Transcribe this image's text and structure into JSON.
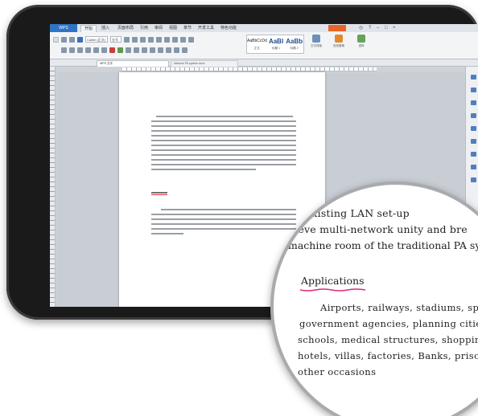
{
  "app": {
    "menu_tabs": [
      "开始",
      "插入",
      "页面布局",
      "引用",
      "审阅",
      "视图",
      "章节",
      "开发工具",
      "特色功能"
    ],
    "active_tab": "开始"
  },
  "ribbon": {
    "font_name": "Calibri (正文)",
    "font_size": "五号",
    "styles": [
      {
        "sample": "AaBbCcDd",
        "caption": "正文"
      },
      {
        "sample": "AaBl",
        "caption": "标题 1"
      },
      {
        "sample": "AaBb",
        "caption": "标题 2"
      }
    ],
    "big_tools": [
      {
        "caption": "文字排版",
        "color": "#6f8fb8"
      },
      {
        "caption": "查找替换",
        "color": "#e08a2e"
      },
      {
        "caption": "选择",
        "color": "#66a35a"
      }
    ]
  },
  "document": {
    "tab_label": "WPS 文字",
    "tab2_label": "Network PA system.docx"
  },
  "magnified": {
    "line1": "e existing LAN set-up",
    "line2": "hieve multi-network unity and bre",
    "line3": "machine room of the traditional PA syste",
    "heading": "Applications",
    "para1": "Airports, railways, stadiums, sports venu",
    "para2": "government agencies, planning cities, institu",
    "para3": "schools, medical structures, shopping malls s",
    "para4": "hotels, villas, factories, Banks, prison deter",
    "para5": "other occasions"
  },
  "colors": {
    "accent": "#2f74c4",
    "underline": "#e0287a",
    "bezel": "#1a1a1a"
  }
}
